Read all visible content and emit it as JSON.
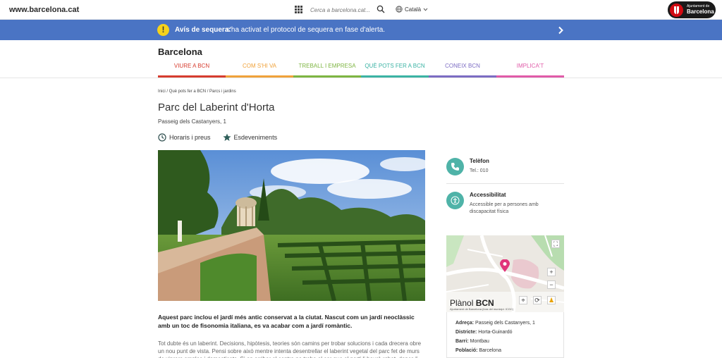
{
  "topbar": {
    "site_url": "www.barcelona.cat",
    "search_placeholder": "Cerca a barcelona.cat...",
    "language": "Català",
    "logo_line1": "Ajuntament de",
    "logo_line2": "Barcelona"
  },
  "alert": {
    "title": "Avís de sequera:",
    "text": "s'ha activat el protocol de sequera en fase d'alerta.",
    "color": "#4a74c4"
  },
  "header": {
    "brand": "Barcelona",
    "nav": [
      {
        "label": "VIURE A BCN",
        "color": "#d63c2f"
      },
      {
        "label": "COM S'HI VA",
        "color": "#f0a23a"
      },
      {
        "label": "TREBALL I EMPRESA",
        "color": "#7eb542"
      },
      {
        "label": "QUÈ POTS FER A BCN",
        "color": "#3bb3a4"
      },
      {
        "label": "CONEIX BCN",
        "color": "#7c6cc3"
      },
      {
        "label": "IMPLICA'T",
        "color": "#e05ba8"
      }
    ]
  },
  "page": {
    "breadcrumb": "Inici / Què pots fer a BCN / Parcs i jardins",
    "title": "Parc del Laberint d'Horta",
    "address": "Passeig dels Castanyers, 1",
    "actions": {
      "schedules": "Horaris i preus",
      "events": "Esdeveniments"
    },
    "intro": "Aquest parc inclou el jardí més antic conservat a la ciutat. Nascut com un jardí neoclàssic amb un toc de fisonomia italiana, es va acabar com a jardí romàntic.",
    "body": "Tot dubte és un laberint. Decisions, hipòtesis, teories són camins per trobar solucions i cada drecera obre un nou punt de vista. Pensi sobre això mentre intenta desentrellar el laberint vegetal del parc fet de murs de xiprers amples i domesticats. Si en arribar al centre no troba el cor que el porti li haurà robat, doncs li"
  },
  "sidebar": {
    "phone": {
      "title": "Telèfon",
      "value": "Tel.: 010"
    },
    "accessibility": {
      "title": "Accessibilitat",
      "value": "Accessible per a persones amb discapacitat física"
    },
    "map": {
      "brand_light": "Plànol ",
      "brand_bold": "BCN",
      "credit": "Ajuntament de Barcelona (fora del municipi: ICGC)"
    },
    "details": [
      {
        "label": "Adreça:",
        "value": "Passeig dels Castanyers, 1"
      },
      {
        "label": "Districte:",
        "value": "Horta-Guinardó"
      },
      {
        "label": "Barri:",
        "value": "Montbau"
      },
      {
        "label": "Població:",
        "value": "Barcelona"
      }
    ]
  }
}
